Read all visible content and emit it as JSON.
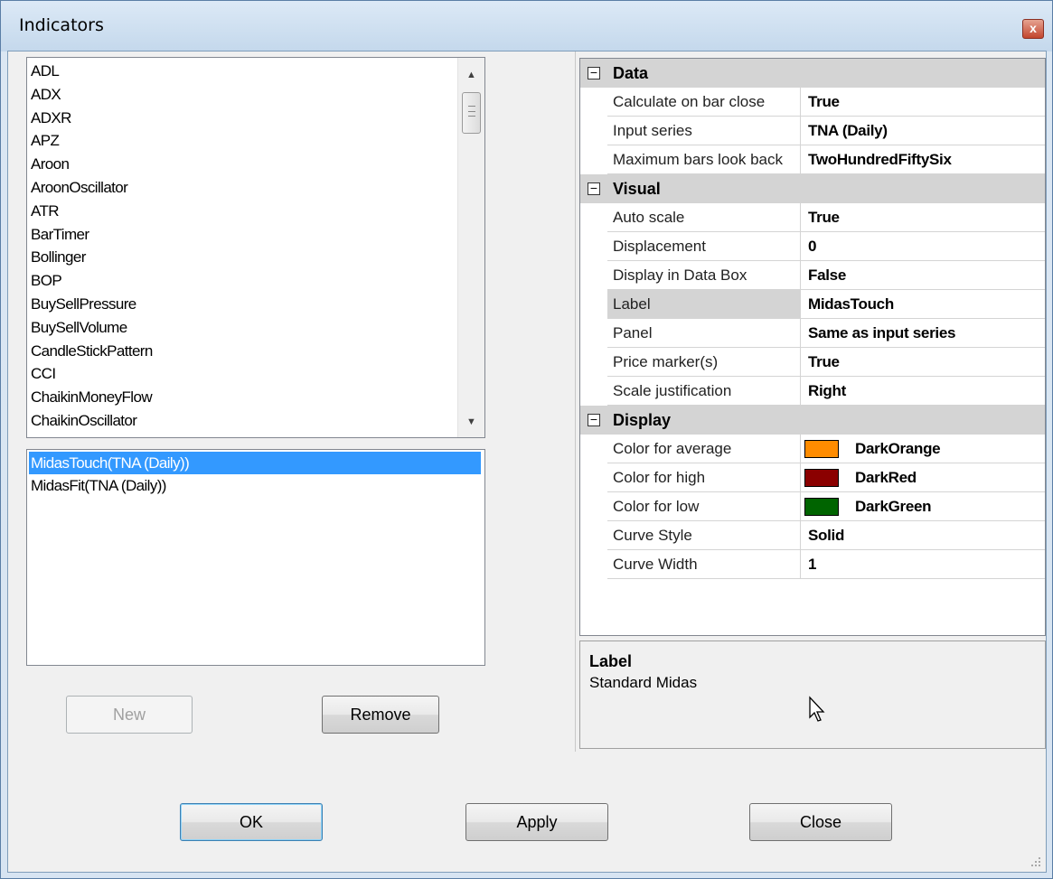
{
  "window": {
    "title": "Indicators",
    "close_glyph": "x"
  },
  "indicator_list": {
    "items": [
      "ADL",
      "ADX",
      "ADXR",
      "APZ",
      "Aroon",
      "AroonOscillator",
      "ATR",
      "BarTimer",
      "Bollinger",
      "BOP",
      "BuySellPressure",
      "BuySellVolume",
      "CandleStickPattern",
      "CCI",
      "ChaikinMoneyFlow",
      "ChaikinOscillator"
    ]
  },
  "applied_list": {
    "items": [
      "MidasTouch(TNA (Daily))",
      "MidasFit(TNA (Daily))"
    ],
    "selected_index": 0
  },
  "buttons": {
    "new": "New",
    "remove": "Remove",
    "ok": "OK",
    "apply": "Apply",
    "close": "Close"
  },
  "properties": {
    "categories": [
      {
        "name": "Data",
        "toggle": "−",
        "rows": [
          {
            "name": "Calculate on bar close",
            "value": "True"
          },
          {
            "name": "Input series",
            "value": "TNA (Daily)"
          },
          {
            "name": "Maximum bars look back",
            "value": "TwoHundredFiftySix"
          }
        ]
      },
      {
        "name": "Visual",
        "toggle": "−",
        "rows": [
          {
            "name": "Auto scale",
            "value": "True"
          },
          {
            "name": "Displacement",
            "value": "0"
          },
          {
            "name": "Display in Data Box",
            "value": "False"
          },
          {
            "name": "Label",
            "value": "MidasTouch"
          },
          {
            "name": "Panel",
            "value": "Same as input series"
          },
          {
            "name": "Price marker(s)",
            "value": "True"
          },
          {
            "name": "Scale justification",
            "value": "Right"
          }
        ]
      },
      {
        "name": "Display",
        "toggle": "−",
        "rows": [
          {
            "name": "Color for average",
            "value": "DarkOrange",
            "color": "#ff8c00"
          },
          {
            "name": "Color for high",
            "value": "DarkRed",
            "color": "#8b0000"
          },
          {
            "name": "Color for low",
            "value": "DarkGreen",
            "color": "#006400"
          },
          {
            "name": "Curve Style",
            "value": "Solid"
          },
          {
            "name": "Curve Width",
            "value": "1"
          }
        ]
      }
    ],
    "selected_row": "Label"
  },
  "description": {
    "title": "Label",
    "text": "Standard Midas"
  },
  "colors": {
    "selection": "#3399ff",
    "category_bg": "#d4d4d4"
  }
}
